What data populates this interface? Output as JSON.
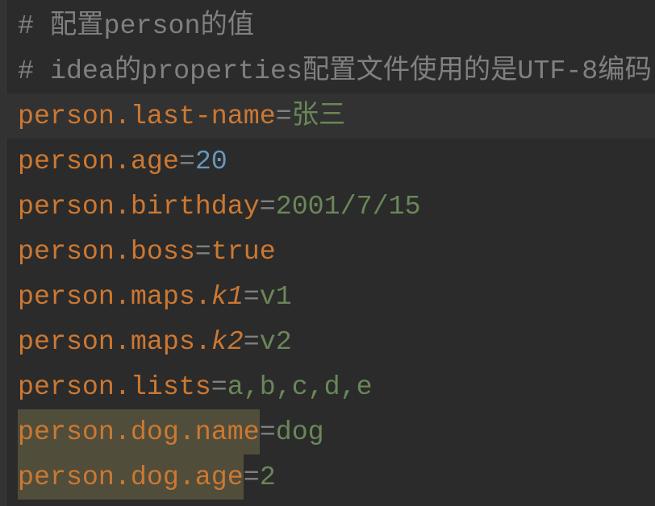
{
  "comments": [
    "# 配置person的值",
    "# idea的properties配置文件使用的是UTF-8编码"
  ],
  "lines": [
    {
      "key": "person.last-name",
      "value": "张三"
    },
    {
      "key": "person.age",
      "value": "20"
    },
    {
      "key": "person.birthday",
      "value": "2001/7/15"
    },
    {
      "key": "person.boss",
      "value": "true"
    },
    {
      "key_prefix": "person.maps.",
      "key_suffix": "k1",
      "value": "v1"
    },
    {
      "key_prefix": "person.maps.",
      "key_suffix": "k2",
      "value": "v2"
    },
    {
      "key": "person.lists",
      "value": "a,b,c,d,e"
    },
    {
      "key": "person.dog.name",
      "value": "dog"
    },
    {
      "key": "person.dog.age",
      "value": "2"
    }
  ],
  "separator": "=",
  "colors": {
    "background": "#2b2b2b",
    "key": "#cc7832",
    "value": "#6a8759",
    "number": "#6897bb",
    "comment": "#808080",
    "highlight": "#504d3b"
  }
}
